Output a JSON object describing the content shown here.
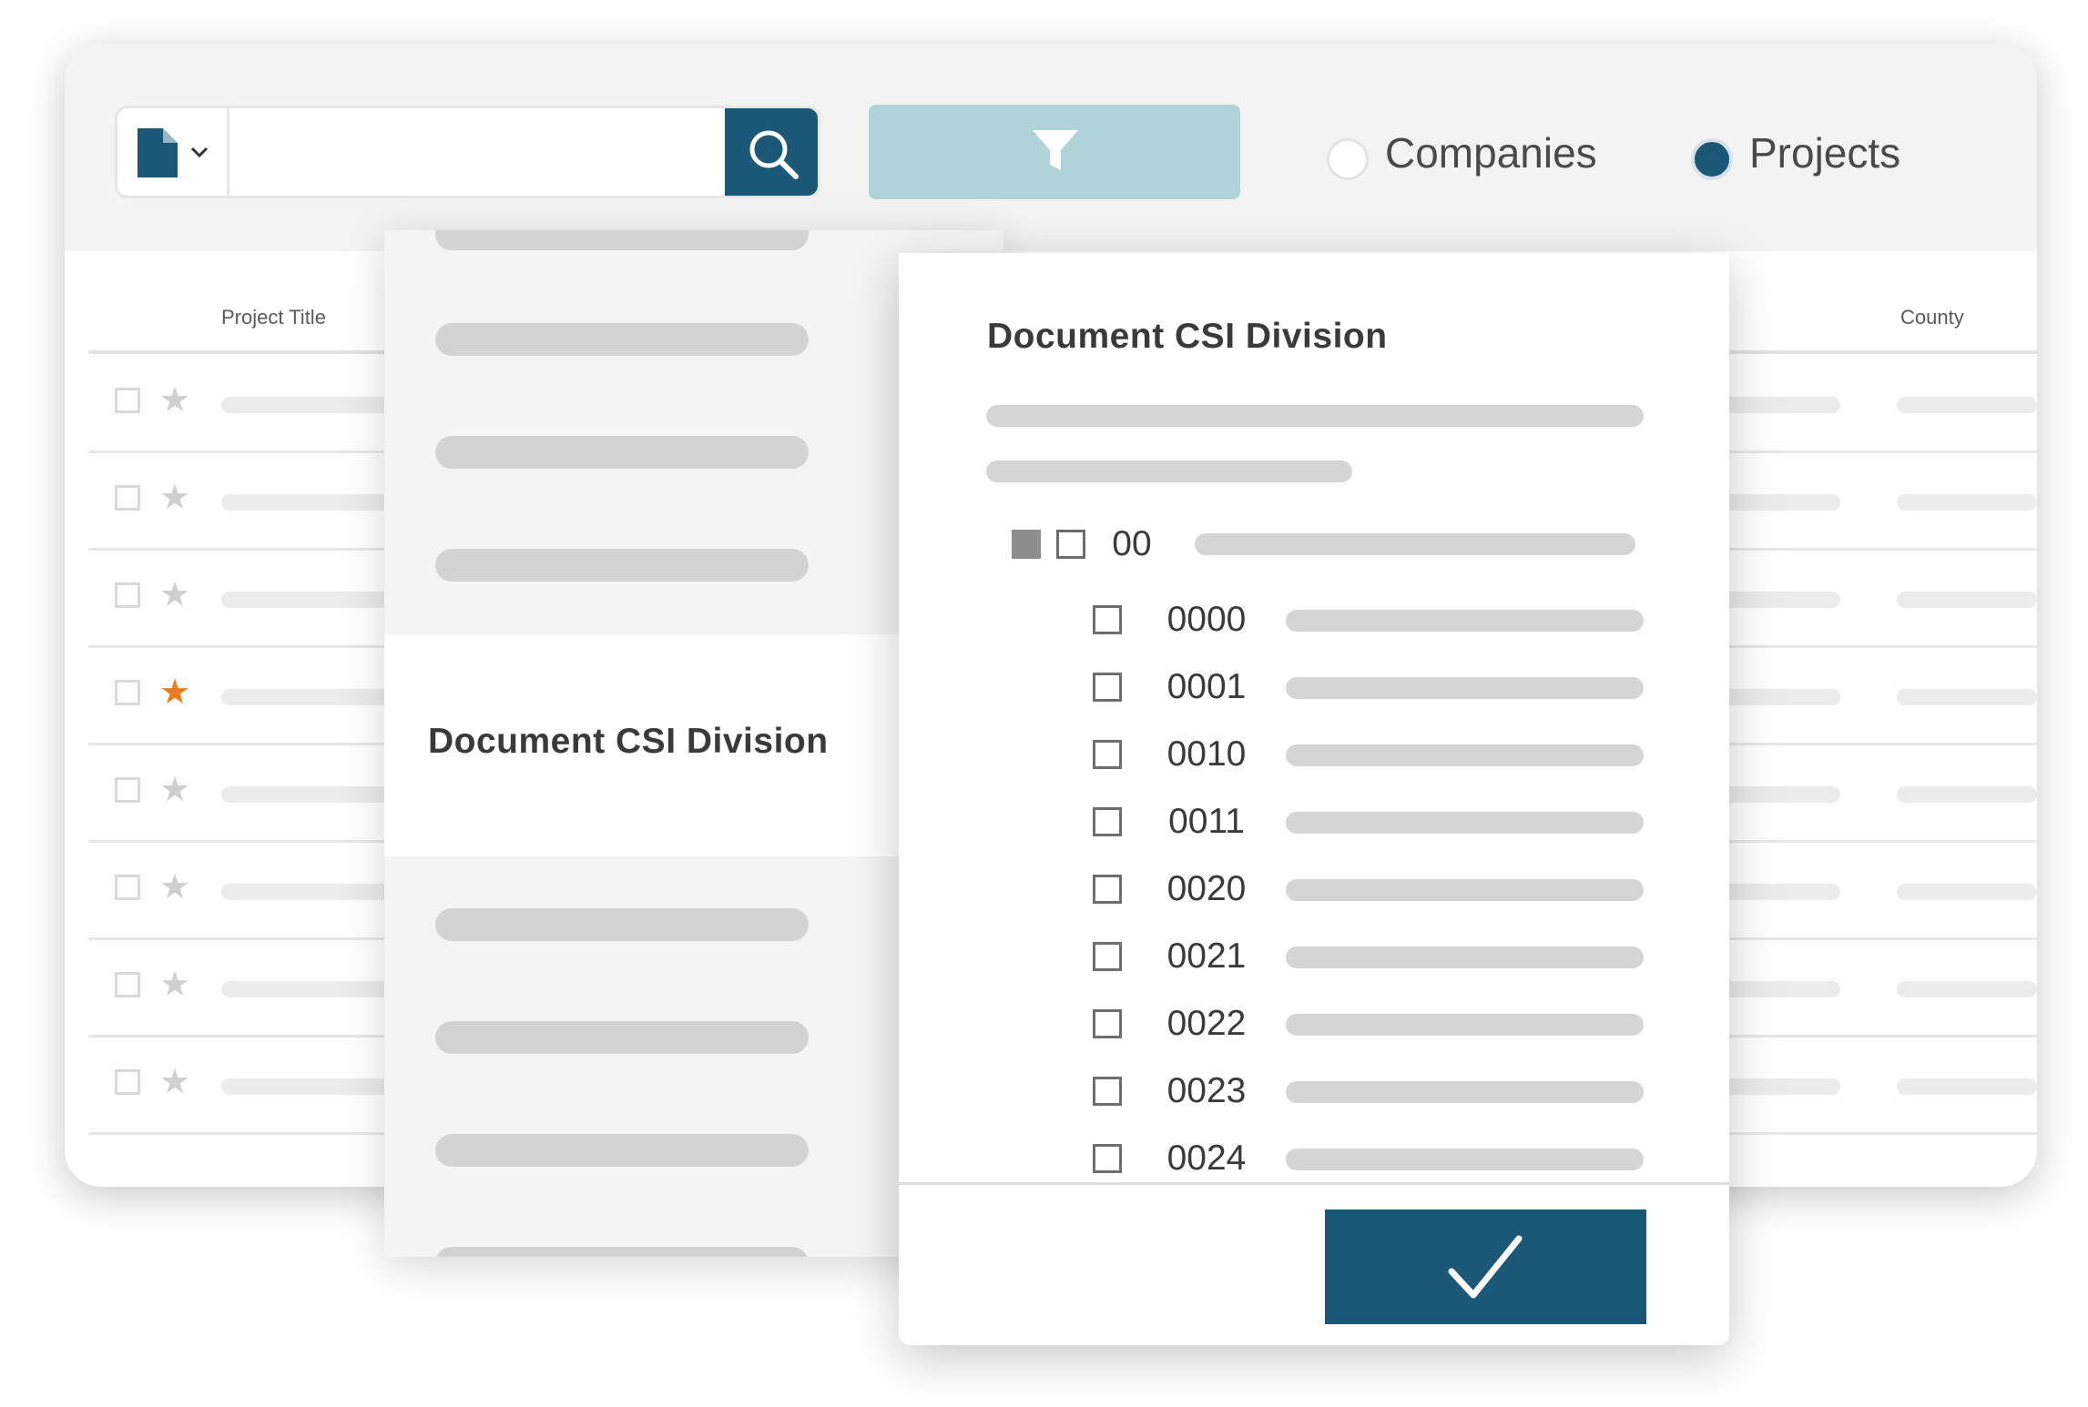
{
  "toolbar": {
    "search": {
      "placeholder": "",
      "value": ""
    },
    "document_type_icon": "document-icon",
    "search_icon": "search-icon",
    "filter_icon": "funnel-icon",
    "radio_options": [
      {
        "label": "Companies",
        "selected": false
      },
      {
        "label": "Projects",
        "selected": true
      }
    ]
  },
  "table": {
    "columns": [
      "Project Title",
      "County"
    ],
    "rows": [
      {
        "starred": false
      },
      {
        "starred": false
      },
      {
        "starred": false
      },
      {
        "starred": true
      },
      {
        "starred": false
      },
      {
        "starred": false
      },
      {
        "starred": false
      },
      {
        "starred": false
      }
    ]
  },
  "side_panel": {
    "selected_item": "Document CSI Division"
  },
  "dialog": {
    "title": "Document CSI Division",
    "group": {
      "code": "00",
      "checked": false
    },
    "items": [
      {
        "code": "0000",
        "checked": false
      },
      {
        "code": "0001",
        "checked": false
      },
      {
        "code": "0010",
        "checked": false
      },
      {
        "code": "0011",
        "checked": false
      },
      {
        "code": "0020",
        "checked": false
      },
      {
        "code": "0021",
        "checked": false
      },
      {
        "code": "0022",
        "checked": false
      },
      {
        "code": "0023",
        "checked": false
      },
      {
        "code": "0024",
        "checked": false
      }
    ],
    "confirm_icon": "checkmark-icon"
  },
  "colors": {
    "primary": "#1b5877",
    "filter": "#afd3d9",
    "star_active": "#f07d1a",
    "toolbar_bg": "#f3f3f3"
  }
}
